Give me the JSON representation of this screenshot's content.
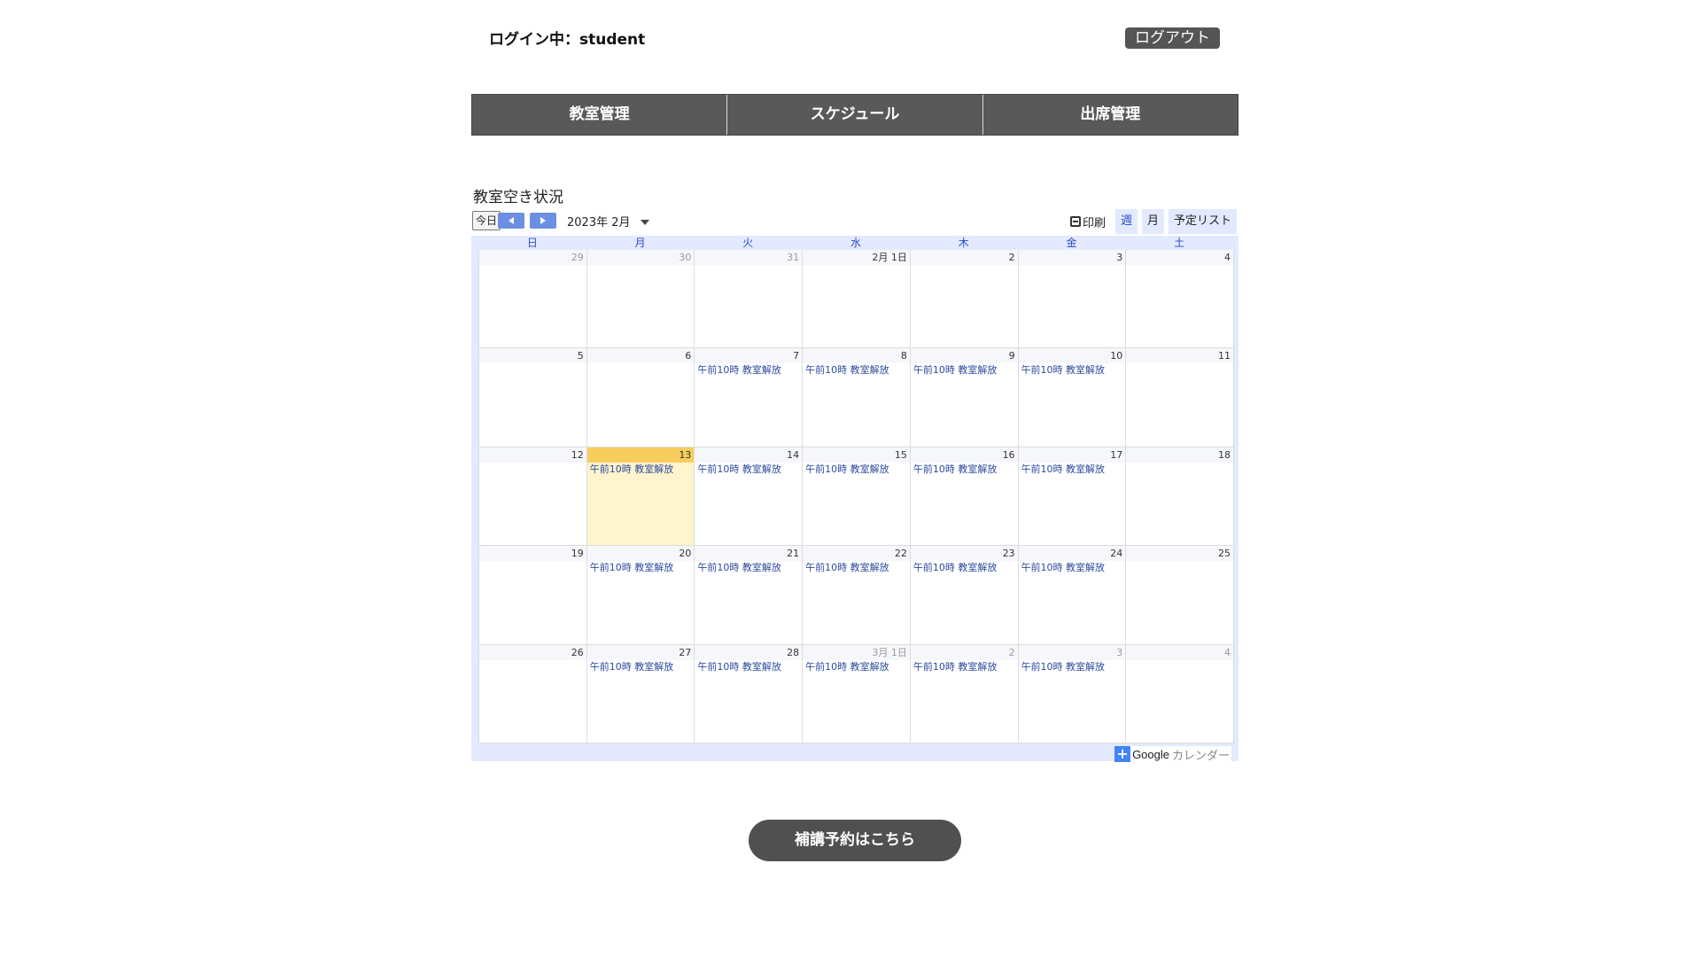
{
  "header": {
    "login_status": "ログイン中：student",
    "logout_label": "ログアウト"
  },
  "nav": {
    "items": [
      {
        "label": "教室管理"
      },
      {
        "label": "スケジュール"
      },
      {
        "label": "出席管理"
      }
    ]
  },
  "section_title": "教室空き状況",
  "calendar": {
    "today_label": "今日",
    "month_label": "2023年 2月",
    "print_label": "印刷",
    "views": [
      "週",
      "月",
      "予定リスト"
    ],
    "active_view": "週",
    "weekdays": [
      "日",
      "月",
      "火",
      "水",
      "木",
      "金",
      "土"
    ],
    "event_label": "午前10時 教室解放",
    "weeks": [
      [
        {
          "day": "29",
          "other": true,
          "events": []
        },
        {
          "day": "30",
          "other": true,
          "events": []
        },
        {
          "day": "31",
          "other": true,
          "events": []
        },
        {
          "day": "2月 1日",
          "other": false,
          "events": []
        },
        {
          "day": "2",
          "other": false,
          "events": []
        },
        {
          "day": "3",
          "other": false,
          "events": []
        },
        {
          "day": "4",
          "other": false,
          "events": []
        }
      ],
      [
        {
          "day": "5",
          "other": false,
          "events": []
        },
        {
          "day": "6",
          "other": false,
          "events": []
        },
        {
          "day": "7",
          "other": false,
          "events": [
            "午前10時 教室解放"
          ]
        },
        {
          "day": "8",
          "other": false,
          "events": [
            "午前10時 教室解放"
          ]
        },
        {
          "day": "9",
          "other": false,
          "events": [
            "午前10時 教室解放"
          ]
        },
        {
          "day": "10",
          "other": false,
          "events": [
            "午前10時 教室解放"
          ]
        },
        {
          "day": "11",
          "other": false,
          "events": []
        }
      ],
      [
        {
          "day": "12",
          "other": false,
          "events": []
        },
        {
          "day": "13",
          "other": false,
          "today": true,
          "events": [
            "午前10時 教室解放"
          ]
        },
        {
          "day": "14",
          "other": false,
          "events": [
            "午前10時 教室解放"
          ]
        },
        {
          "day": "15",
          "other": false,
          "events": [
            "午前10時 教室解放"
          ]
        },
        {
          "day": "16",
          "other": false,
          "events": [
            "午前10時 教室解放"
          ]
        },
        {
          "day": "17",
          "other": false,
          "events": [
            "午前10時 教室解放"
          ]
        },
        {
          "day": "18",
          "other": false,
          "events": []
        }
      ],
      [
        {
          "day": "19",
          "other": false,
          "events": []
        },
        {
          "day": "20",
          "other": false,
          "events": [
            "午前10時 教室解放"
          ]
        },
        {
          "day": "21",
          "other": false,
          "events": [
            "午前10時 教室解放"
          ]
        },
        {
          "day": "22",
          "other": false,
          "events": [
            "午前10時 教室解放"
          ]
        },
        {
          "day": "23",
          "other": false,
          "events": [
            "午前10時 教室解放"
          ]
        },
        {
          "day": "24",
          "other": false,
          "events": [
            "午前10時 教室解放"
          ]
        },
        {
          "day": "25",
          "other": false,
          "events": []
        }
      ],
      [
        {
          "day": "26",
          "other": false,
          "events": []
        },
        {
          "day": "27",
          "other": false,
          "events": [
            "午前10時 教室解放"
          ]
        },
        {
          "day": "28",
          "other": false,
          "events": [
            "午前10時 教室解放"
          ]
        },
        {
          "day": "3月 1日",
          "other": true,
          "events": [
            "午前10時 教室解放"
          ]
        },
        {
          "day": "2",
          "other": true,
          "events": [
            "午前10時 教室解放"
          ]
        },
        {
          "day": "3",
          "other": true,
          "events": [
            "午前10時 教室解放"
          ]
        },
        {
          "day": "4",
          "other": true,
          "events": []
        }
      ]
    ],
    "footer": {
      "google_word": "Google",
      "calendar_word": "カレンダー"
    }
  },
  "makeup_button_label": "補講予約はこちら",
  "colors": {
    "nav_bg": "#595959",
    "accent_blue": "#6d8fe3",
    "today_header": "#f7cd5e",
    "today_bg": "#fff4cc",
    "event_text": "#2c4b9f"
  }
}
